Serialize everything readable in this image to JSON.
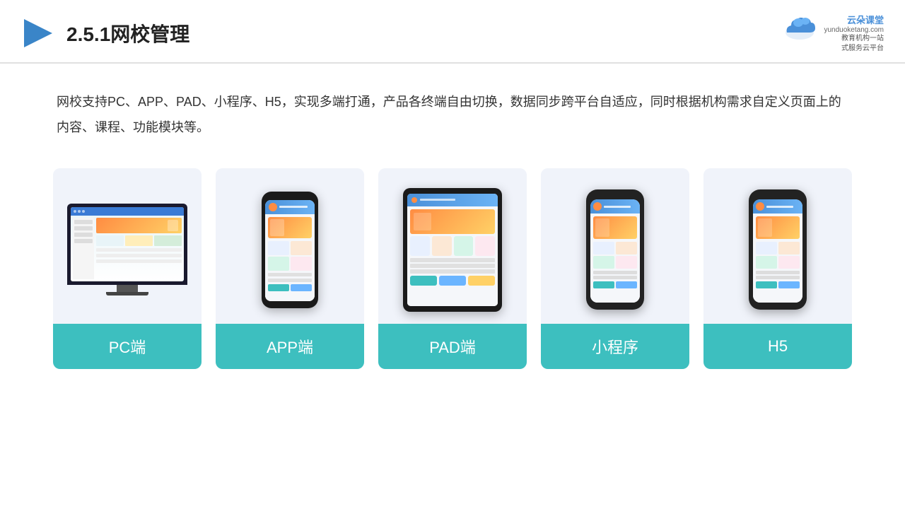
{
  "header": {
    "title": "2.5.1网校管理",
    "logo": {
      "brand": "云朵课堂",
      "url": "yunduoketang.com",
      "slogan_line1": "教育机构一站",
      "slogan_line2": "式服务云平台"
    }
  },
  "description": {
    "text": "网校支持PC、APP、PAD、小程序、H5，实现多端打通，产品各终端自由切换，数据同步跨平台自适应，同时根据机构需求自定义页面上的内容、课程、功能模块等。"
  },
  "cards": [
    {
      "id": "pc",
      "label": "PC端"
    },
    {
      "id": "app",
      "label": "APP端"
    },
    {
      "id": "pad",
      "label": "PAD端"
    },
    {
      "id": "miniprogram",
      "label": "小程序"
    },
    {
      "id": "h5",
      "label": "H5"
    }
  ],
  "colors": {
    "accent": "#3dbfbf",
    "background_card": "#f0f3fa",
    "header_border": "#e0e0e0",
    "title_color": "#222",
    "body_color": "#333"
  }
}
